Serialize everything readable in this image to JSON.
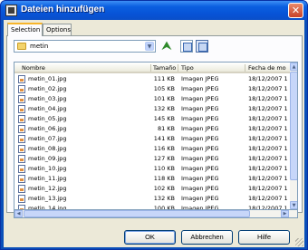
{
  "window": {
    "title": "Dateien hinzufügen"
  },
  "tabs": [
    {
      "label": "Selection",
      "active": true
    },
    {
      "label": "Options",
      "active": false
    }
  ],
  "folder": {
    "current": "metin"
  },
  "columns": [
    "Nombre",
    "Tamaño",
    "Tipo",
    "Fecha de mo"
  ],
  "files": [
    {
      "name": "metin_01.jpg",
      "size": "111 KB",
      "type": "Imagen JPEG",
      "date": "18/12/2007 1"
    },
    {
      "name": "metin_02.jpg",
      "size": "105 KB",
      "type": "Imagen JPEG",
      "date": "18/12/2007 1"
    },
    {
      "name": "metin_03.jpg",
      "size": "101 KB",
      "type": "Imagen JPEG",
      "date": "18/12/2007 1"
    },
    {
      "name": "metin_04.jpg",
      "size": "132 KB",
      "type": "Imagen JPEG",
      "date": "18/12/2007 1"
    },
    {
      "name": "metin_05.jpg",
      "size": "145 KB",
      "type": "Imagen JPEG",
      "date": "18/12/2007 1"
    },
    {
      "name": "metin_06.jpg",
      "size": "81 KB",
      "type": "Imagen JPEG",
      "date": "18/12/2007 1"
    },
    {
      "name": "metin_07.jpg",
      "size": "141 KB",
      "type": "Imagen JPEG",
      "date": "18/12/2007 1"
    },
    {
      "name": "metin_08.jpg",
      "size": "116 KB",
      "type": "Imagen JPEG",
      "date": "18/12/2007 1"
    },
    {
      "name": "metin_09.jpg",
      "size": "127 KB",
      "type": "Imagen JPEG",
      "date": "18/12/2007 1"
    },
    {
      "name": "metin_10.jpg",
      "size": "110 KB",
      "type": "Imagen JPEG",
      "date": "18/12/2007 1"
    },
    {
      "name": "metin_11.jpg",
      "size": "118 KB",
      "type": "Imagen JPEG",
      "date": "18/12/2007 1"
    },
    {
      "name": "metin_12.jpg",
      "size": "102 KB",
      "type": "Imagen JPEG",
      "date": "18/12/2007 1"
    },
    {
      "name": "metin_13.jpg",
      "size": "132 KB",
      "type": "Imagen JPEG",
      "date": "18/12/2007 1"
    },
    {
      "name": "metin_14.jpg",
      "size": "100 KB",
      "type": "Imagen JPEG",
      "date": "18/12/2007 1"
    }
  ],
  "buttons": {
    "ok": "OK",
    "cancel": "Abbrechen",
    "help": "Hilfe"
  },
  "icons": {
    "app": "app-icon",
    "close": "close-icon",
    "folder": "folder-icon",
    "up": "up-folder-icon",
    "list_view": "list-view-icon",
    "details_view": "details-view-icon",
    "file": "jpeg-file-icon"
  },
  "colors": {
    "titlebar": "#0753d6",
    "tab_highlight": "#f7b52b",
    "dialog": "#ece9d8"
  }
}
